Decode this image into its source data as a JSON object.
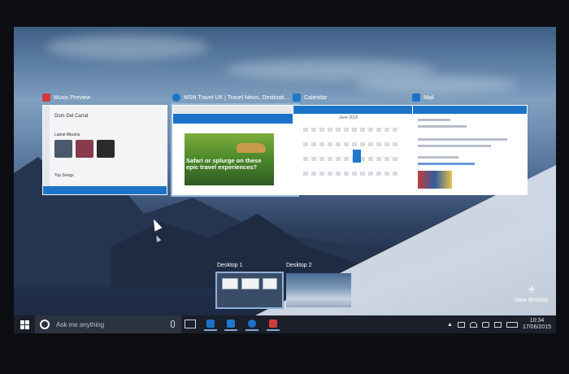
{
  "windows": [
    {
      "title": "Music Preview",
      "icon": "music-icon",
      "color": "#d23a3a",
      "content": {
        "heading": "Dom Del Carral",
        "section": "Latest Albums",
        "footer": "Top Songs"
      }
    },
    {
      "title": "MSN Travel UK | Travel News, Destinati...",
      "icon": "msn-icon",
      "color": "#1a73c9",
      "content": {
        "headline": "Safari or splurge on these epic travel experiences?"
      }
    },
    {
      "title": "Calendar",
      "icon": "calendar-icon",
      "color": "#1e78cc",
      "content": {
        "month": "June 2015"
      }
    },
    {
      "title": "Mail",
      "icon": "mail-icon",
      "color": "#1a73c9",
      "content": {}
    }
  ],
  "desktops": [
    {
      "label": "Desktop 1",
      "active": true
    },
    {
      "label": "Desktop 2",
      "active": false
    }
  ],
  "new_desktop": {
    "label": "New desktop",
    "icon": "plus-icon"
  },
  "taskbar": {
    "search_placeholder": "Ask me anything",
    "apps": [
      {
        "icon": "mail-icon",
        "color": "#1a73c9"
      },
      {
        "icon": "calendar-icon",
        "color": "#1e78cc"
      },
      {
        "icon": "msn-icon",
        "color": "#1a73c9"
      },
      {
        "icon": "music-icon",
        "color": "#d23a3a"
      }
    ],
    "clock": {
      "time": "10:34",
      "date": "17/06/2015"
    }
  }
}
